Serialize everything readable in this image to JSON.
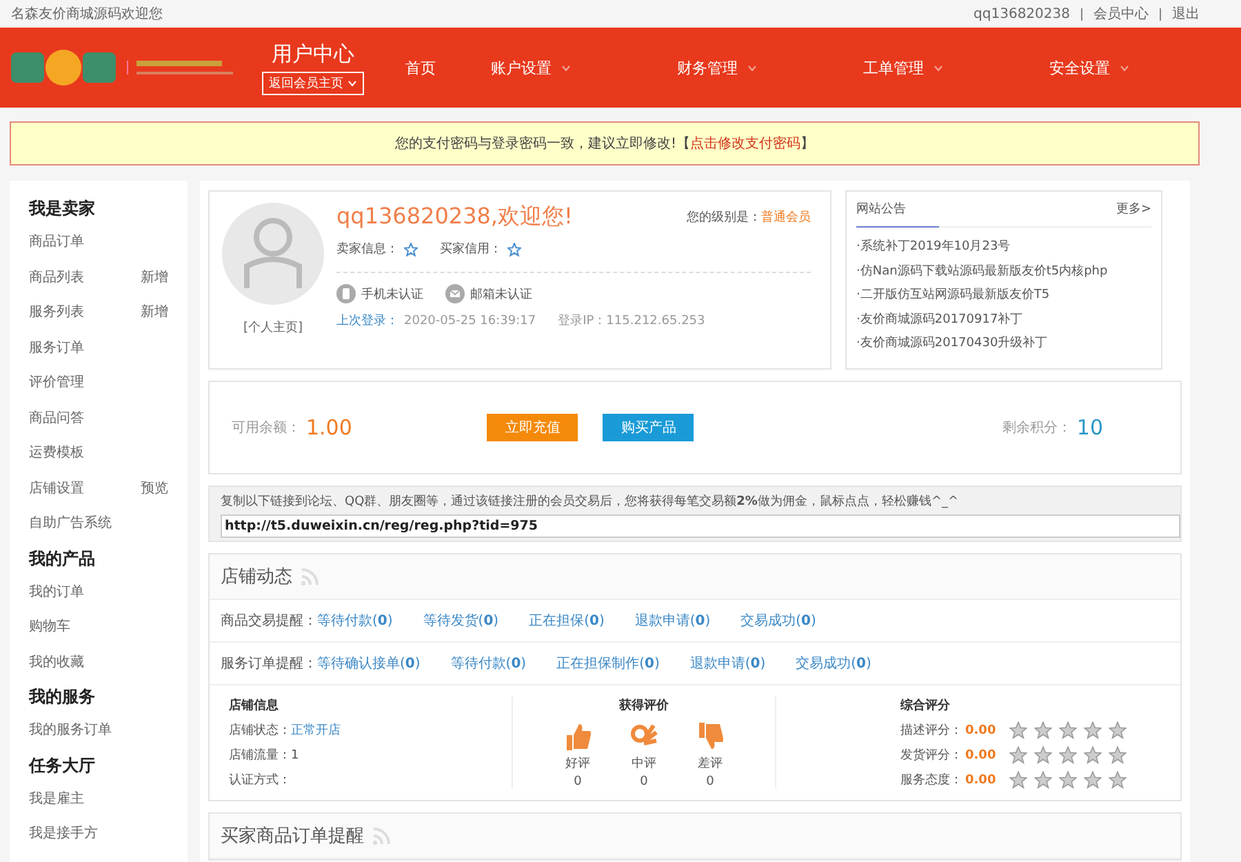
{
  "top_bar": {
    "welcome": "名森友价商城源码欢迎您",
    "links": [
      "qq136820238",
      "会员中心",
      "退出"
    ]
  },
  "header": {
    "title": "用户中心",
    "back_button": "返回会员主页",
    "nav": [
      {
        "label": "首页",
        "has_menu": false
      },
      {
        "label": "账户设置",
        "has_menu": true
      },
      {
        "label": "财务管理",
        "has_menu": true
      },
      {
        "label": "工单管理",
        "has_menu": true
      },
      {
        "label": "安全设置",
        "has_menu": true
      }
    ]
  },
  "alert": {
    "text": "您的支付密码与登录密码一致，建议立即修改!【",
    "link": "点击修改支付密码",
    "tail": "】"
  },
  "sidebar": [
    {
      "title": "我是卖家",
      "items": [
        {
          "label": "商品订单"
        },
        {
          "label": "商品列表",
          "action": "新增"
        },
        {
          "label": "服务列表",
          "action": "新增"
        },
        {
          "label": "服务订单"
        },
        {
          "label": "评价管理"
        },
        {
          "label": "商品问答"
        },
        {
          "label": "运费模板"
        },
        {
          "label": "店铺设置",
          "action": "预览"
        },
        {
          "label": "自助广告系统"
        }
      ]
    },
    {
      "title": "我的产品",
      "items": [
        {
          "label": "我的订单"
        },
        {
          "label": "购物车"
        },
        {
          "label": "我的收藏"
        }
      ]
    },
    {
      "title": "我的服务",
      "items": [
        {
          "label": "我的服务订单"
        }
      ]
    },
    {
      "title": "任务大厅",
      "items": [
        {
          "label": "我是雇主"
        },
        {
          "label": "我是接手方"
        }
      ]
    }
  ],
  "profile": {
    "homepage": "[个人主页]",
    "greeting": "qq136820238,欢迎您!",
    "level_label": "您的级别是：",
    "level": "普通会员",
    "seller_credit": "卖家信息：",
    "buyer_credit": "买家信用：",
    "phone": "手机未认证",
    "email": "邮箱未认证",
    "last_login_label": "上次登录：",
    "last_login": "2020-05-25 16:39:17",
    "ip": "登录IP：115.212.65.253"
  },
  "notices": {
    "title": "网站公告",
    "more": "更多>",
    "items": [
      "·系统补丁2019年10月23号",
      "·仿Nan源码下载站源码最新版友价t5内核php",
      "·二开版仿互站网源码最新版友价T5",
      "·友价商城源码20170917补丁",
      "·友价商城源码20170430升级补丁"
    ]
  },
  "balance": {
    "label": "可用余额：",
    "amount": "1.00",
    "recharge": "立即充值",
    "buy": "购买产品",
    "points_label": "剩余积分：",
    "points": "10"
  },
  "referral": {
    "text": "复制以下链接到论坛、QQ群、朋友圈等，通过该链接注册的会员交易后，您将获得每笔交易额**2%**做为佣金，鼠标点点，轻松赚钱^_^",
    "url": "http://t5.duweixin.cn/reg/reg.php?tid=975"
  },
  "store": {
    "title": "店铺动态",
    "rows": [
      {
        "label": "商品交易提醒：",
        "links": [
          {
            "text": "等待付款(**0**)"
          },
          {
            "text": "等待发货(**0**)"
          },
          {
            "text": "正在担保(**0**)"
          },
          {
            "text": "退款申请(**0**)"
          },
          {
            "text": "交易成功(**0**)"
          }
        ]
      },
      {
        "label": "服务订单提醒：",
        "links": [
          {
            "text": "等待确认接单(**0**)"
          },
          {
            "text": "等待付款(**0**)"
          },
          {
            "text": "正在担保制作(**0**)"
          },
          {
            "text": "退款申请(**0**)"
          },
          {
            "text": "交易成功(**0**)"
          }
        ]
      }
    ],
    "info": {
      "title": "店铺信息",
      "status_label": "店铺状态：",
      "status": "正常开店",
      "traffic": "店铺流量：1",
      "auth": "认证方式："
    },
    "reviews": {
      "title": "获得评价",
      "items": [
        {
          "kind": "good",
          "label": "好评",
          "count": "0"
        },
        {
          "kind": "neutral",
          "label": "中评",
          "count": "0"
        },
        {
          "kind": "bad",
          "label": "差评",
          "count": "0"
        }
      ]
    },
    "scores": {
      "title": "综合评分",
      "items": [
        {
          "label": "描述评分：",
          "value": "0.00",
          "stars": 0
        },
        {
          "label": "发货评分：",
          "value": "0.00",
          "stars": 0
        },
        {
          "label": "服务态度：",
          "value": "0.00",
          "stars": 0
        }
      ]
    }
  },
  "buyer": {
    "title": "买家商品订单提醒"
  }
}
